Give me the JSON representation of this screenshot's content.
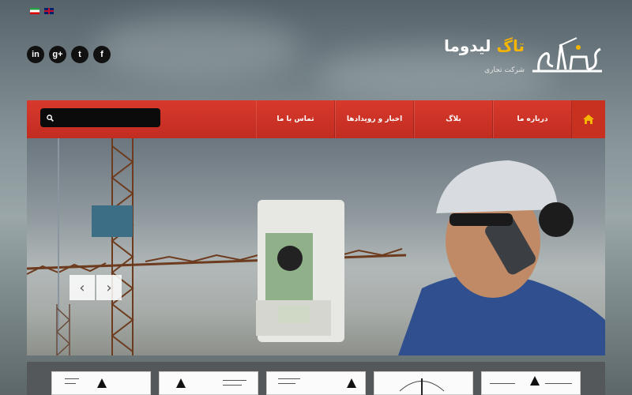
{
  "header": {
    "brand_title_main": "لیدوما",
    "brand_title_accent": "تاگ",
    "brand_subtitle": "شرکت تجاری"
  },
  "languages": [
    {
      "name": "flag-iran-icon"
    },
    {
      "name": "flag-uk-icon"
    }
  ],
  "social": [
    {
      "icon": "linkedin-icon",
      "glyph": "in"
    },
    {
      "icon": "googleplus-icon",
      "glyph": "g+"
    },
    {
      "icon": "twitter-icon",
      "glyph": "t"
    },
    {
      "icon": "facebook-icon",
      "glyph": "f"
    }
  ],
  "nav": {
    "items": [
      {
        "label": "درباره ما"
      },
      {
        "label": "بلاگ"
      },
      {
        "label": "اخبار و رویدادها"
      },
      {
        "label": "تماس با ما"
      }
    ],
    "search_placeholder": ""
  },
  "slider": {
    "prev_glyph": "‹",
    "next_glyph": "›"
  },
  "colors": {
    "nav_red": "#c8301f",
    "accent_yellow": "#f5b500"
  }
}
